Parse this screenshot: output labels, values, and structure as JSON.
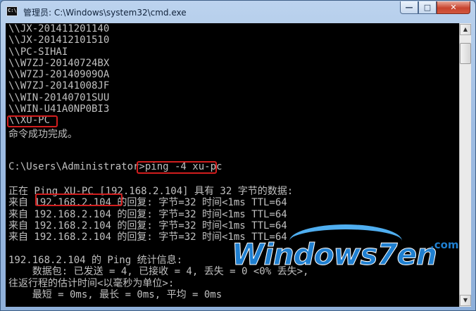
{
  "window": {
    "icon_text": "C:\\",
    "title": "管理员: C:\\Windows\\system32\\cmd.exe",
    "minimize_glyph": "—",
    "maximize_glyph": "□",
    "close_glyph": "✕"
  },
  "console": {
    "lines": [
      "\\\\JX-201411201140",
      "\\\\JX-201412101510",
      "\\\\PC-SIHAI",
      "\\\\W7ZJ-20140724BX",
      "\\\\W7ZJ-20140909OA",
      "\\\\W7ZJ-20141008JF",
      "\\\\WIN-20140701SUU",
      "\\\\WIN-U41A0NP0BI3",
      "\\\\XU-PC",
      "命令成功完成。",
      "",
      "",
      "C:\\Users\\Administrator>ping -4 xu-pc",
      "",
      "正在 Ping XU-PC [192.168.2.104] 具有 32 字节的数据:",
      "来自 192.168.2.104 的回复: 字节=32 时间<1ms TTL=64",
      "来自 192.168.2.104 的回复: 字节=32 时间<1ms TTL=64",
      "来自 192.168.2.104 的回复: 字节=32 时间<1ms TTL=64",
      "来自 192.168.2.104 的回复: 字节=32 时间<1ms TTL=64",
      "",
      "192.168.2.104 的 Ping 统计信息:",
      "    数据包: 已发送 = 4, 已接收 = 4, 丢失 = 0 <0% 丢失>,",
      "往返行程的估计时间<以毫秒为单位>:",
      "    最短 = 0ms, 最长 = 0ms, 平均 = 0ms"
    ]
  },
  "watermark": {
    "text": "Windows7en",
    "suffix": ".com"
  },
  "scrollbar": {
    "up_glyph": "▲",
    "down_glyph": "▼"
  }
}
